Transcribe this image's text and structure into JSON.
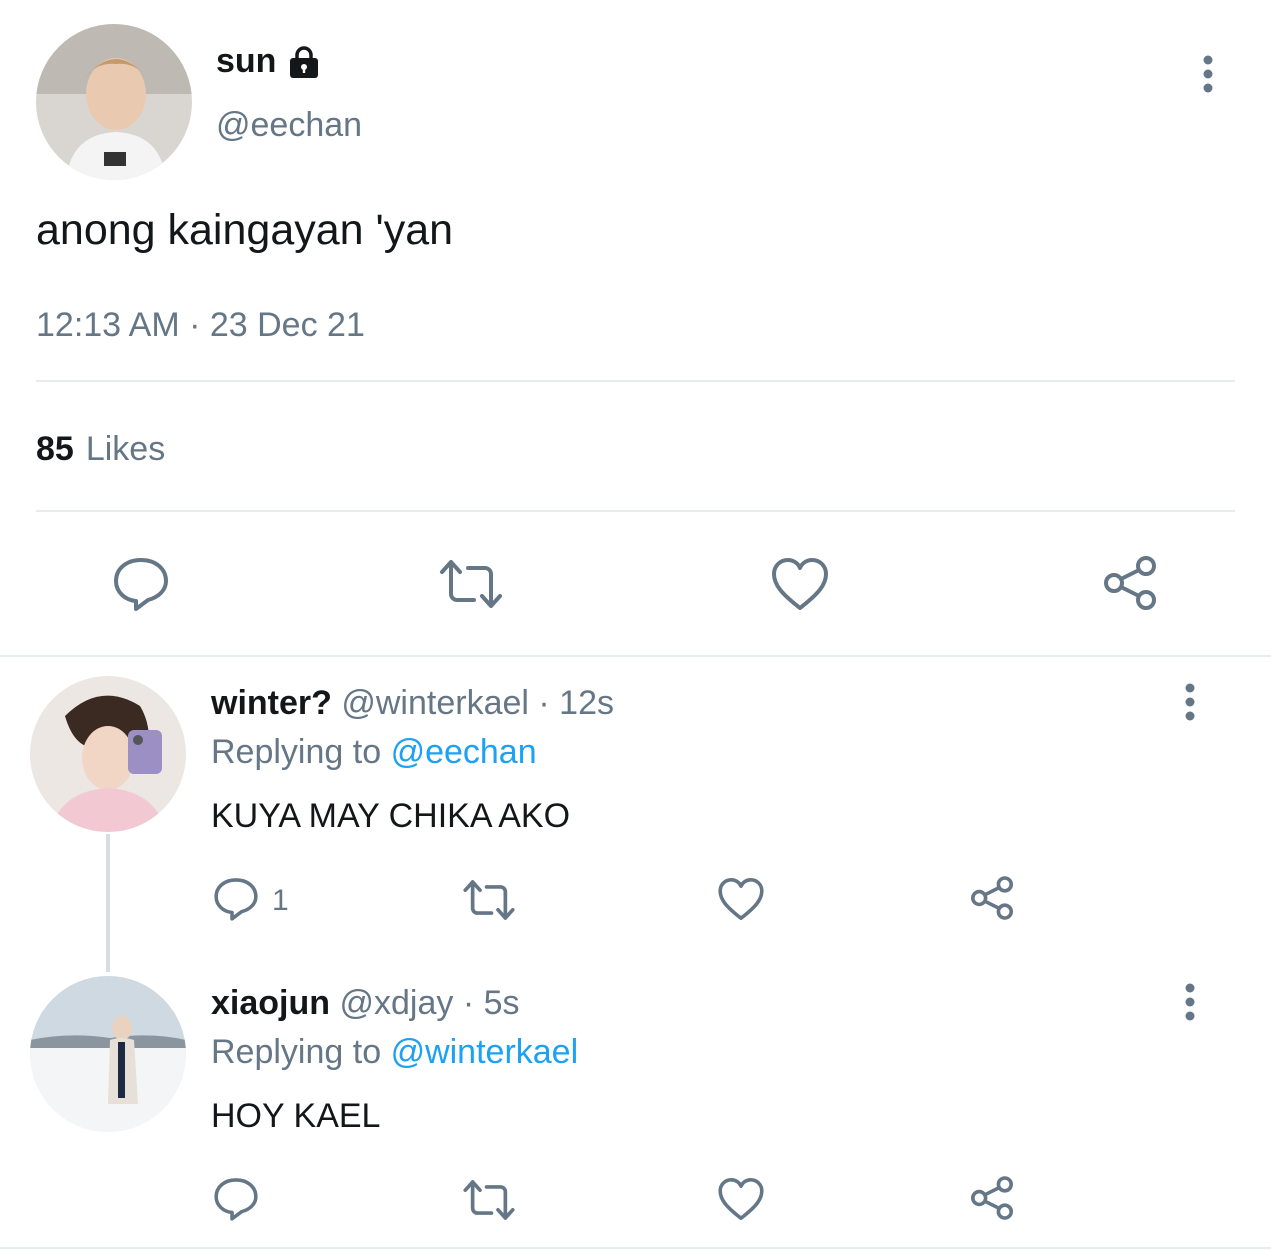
{
  "main_tweet": {
    "display_name": "sun",
    "handle": "@eechan",
    "text": "anong kaingayan 'yan",
    "timestamp": "12:13 AM · 23 Dec 21",
    "likes_count": "85",
    "likes_label": "Likes",
    "protected": true
  },
  "replies": [
    {
      "display_name": "winter?",
      "handle": "@winterkael",
      "time": "· 12s",
      "replying_label": "Replying to",
      "replying_to": "@eechan",
      "text": "KUYA MAY CHIKA AKO",
      "reply_count": "1"
    },
    {
      "display_name": "xiaojun",
      "handle": "@xdjay",
      "time": "· 5s",
      "replying_label": "Replying to",
      "replying_to": "@winterkael",
      "text": "HOY KAEL",
      "reply_count": ""
    }
  ],
  "icons": {
    "reply": "reply-icon",
    "retweet": "retweet-icon",
    "like": "heart-icon",
    "share": "share-icon",
    "more": "more-vertical-icon",
    "lock": "lock-icon"
  },
  "colors": {
    "text_primary": "#14171a",
    "text_secondary": "#657786",
    "link": "#1da1f2",
    "divider": "#e6ecf0",
    "icon": "#657786"
  }
}
